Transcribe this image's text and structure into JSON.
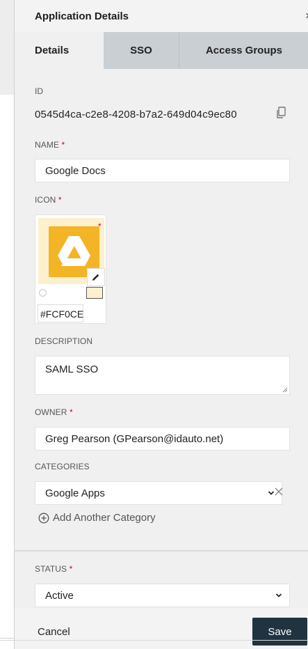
{
  "header": {
    "title": "Application Details",
    "close_glyph": "×"
  },
  "tabs": [
    {
      "label": "Details",
      "active": true
    },
    {
      "label": "SSO",
      "active": false
    },
    {
      "label": "Access Groups",
      "active": false
    }
  ],
  "form": {
    "id_label": "ID",
    "id_value": "0545d4ca-c2e8-4208-b7a2-649d04c9ec80",
    "name_label": "NAME",
    "name_value": "Google Docs",
    "icon_label": "ICON",
    "icon_color_value": "#FCF0CE",
    "description_label": "DESCRIPTION",
    "description_value": "SAML SSO",
    "owner_label": "OWNER",
    "owner_value": "Greg Pearson (GPearson@idauto.net)",
    "categories_label": "CATEGORIES",
    "category_selected": "Google Apps",
    "add_category_label": "Add Another Category",
    "status_label": "STATUS",
    "status_selected": "Active",
    "required_mark": "*"
  },
  "footer": {
    "cancel_label": "Cancel",
    "save_label": "Save"
  },
  "colors": {
    "icon_background": "#FCF0CE",
    "drive_yellow": "#F3B425",
    "save_button": "#1F3340",
    "required": "#D0021B"
  },
  "icons": [
    "copy-icon",
    "google-drive-icon",
    "pencil-icon",
    "chevron-down-icon",
    "close-icon",
    "plus-circle-icon"
  ]
}
